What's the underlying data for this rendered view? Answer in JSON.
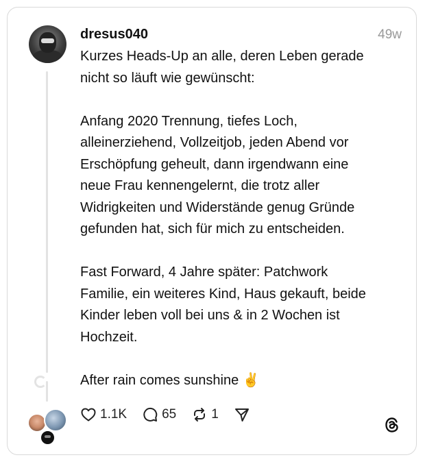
{
  "post": {
    "username": "dresus040",
    "time": "49w",
    "paragraphs": [
      [
        "Kurzes Heads-Up an alle, deren Leben gerade",
        "nicht so läuft wie gewünscht:"
      ],
      [
        "Anfang 2020 Trennung, tiefes Loch,",
        "alleinerziehend, Vollzeitjob, jeden Abend vor",
        "Erschöpfung geheult, dann irgendwann eine",
        "neue Frau kennengelernt, die trotz aller",
        "Widrigkeiten und Widerstände genug Gründe",
        "gefunden hat, sich für mich zu entscheiden."
      ],
      [
        "Fast Forward, 4 Jahre später: Patchwork",
        "Familie, ein weiteres Kind, Haus gekauft, beide",
        "Kinder leben voll bei uns & in 2 Wochen ist",
        "Hochzeit."
      ],
      [
        "After rain comes sunshine ✌️"
      ]
    ]
  },
  "actions": {
    "likes": "1.1K",
    "replies": "65",
    "reposts": "1"
  },
  "icons": {
    "like": "heart-icon",
    "reply": "comment-bubble-icon",
    "repost": "repost-icon",
    "share": "send-icon",
    "logo": "threads-logo-icon"
  }
}
